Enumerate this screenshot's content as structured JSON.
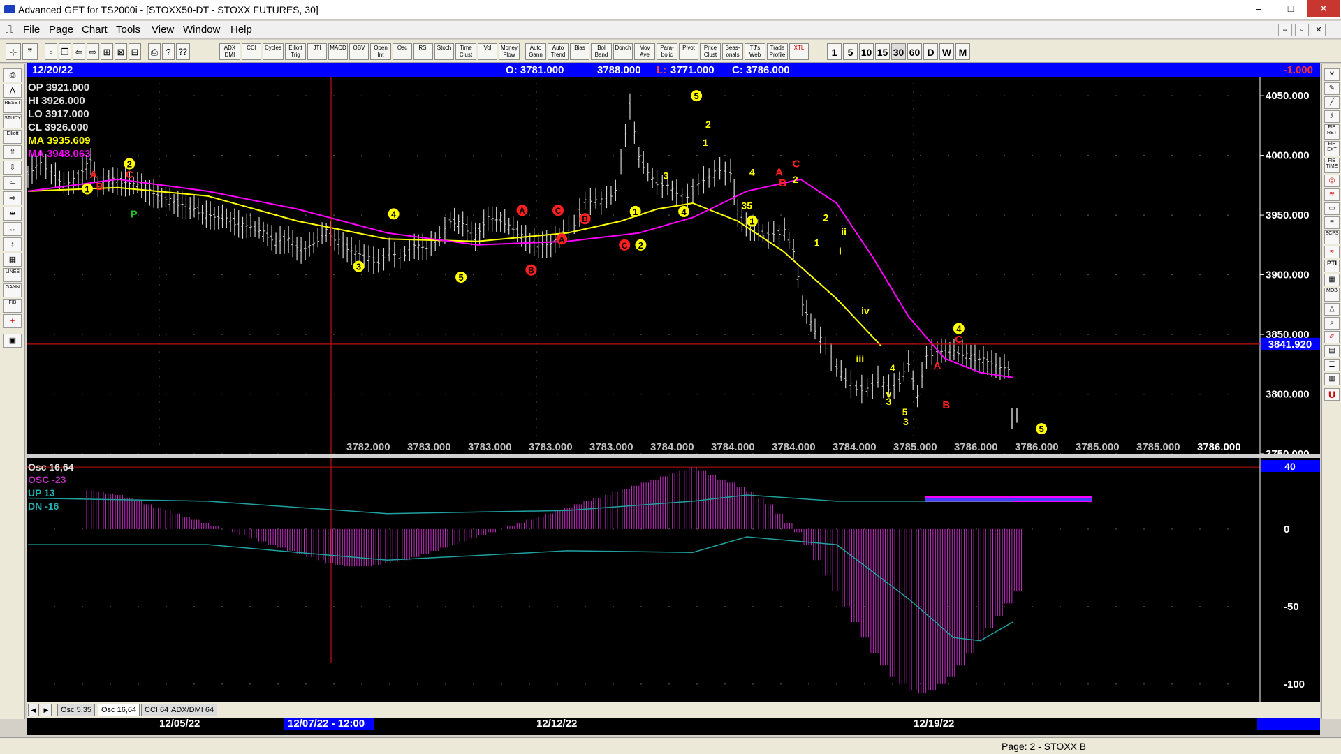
{
  "window": {
    "title": "Advanced GET for TS2000i - [STOXX50-DT - STOXX FUTURES, 30]",
    "minimize": "–",
    "maximize": "□",
    "close": "✕"
  },
  "menu": [
    "File",
    "Page",
    "Chart",
    "Tools",
    "View",
    "Window",
    "Help"
  ],
  "mdi_buttons": [
    "–",
    "▫",
    "✕"
  ],
  "toolbar": {
    "studies": [
      "ADX DMI",
      "CCI",
      "Cycles",
      "Elliott Trig",
      "JTI",
      "MACD",
      "OBV",
      "Open Int",
      "Osc",
      "RSI",
      "Stoch",
      "Time Clust",
      "Vol",
      "Money Flow",
      "Auto Gann",
      "Auto Trend",
      "Bias",
      "Bol Band",
      "Donch",
      "Mov Ave",
      "Para-bolic",
      "Pivot",
      "Price Clust",
      "Seas-onals",
      "TJ's Web",
      "Trade Profile",
      "XTL"
    ],
    "timeframes": [
      "1",
      "5",
      "10",
      "15",
      "30",
      "60",
      "D",
      "W",
      "M"
    ]
  },
  "left_tools": [
    "RESET",
    "STUDY",
    "Elliott",
    "LINES",
    "GANN",
    "FIB"
  ],
  "right_tools": [
    "FIB RET",
    "FIB EXT",
    "FIB TIME",
    "ECPS",
    "PTI",
    "MOB"
  ],
  "colors": {
    "background": "#000000",
    "header_bar": "#0000ff",
    "price_bar": "#d0d0d0",
    "ma_yellow": "#ffff00",
    "ma_magenta": "#ff00ff",
    "wave_yellow": "#ffff00",
    "wave_red": "#ff2020",
    "cursor_red": "#c01010",
    "osc_histogram": "#c030c0",
    "osc_band": "#20a0a0"
  },
  "header": {
    "date": "12/20/22",
    "open": "O: 3781.000",
    "high": "3788.000",
    "low_label": "L:",
    "low": "3771.000",
    "close": "C: 3786.000",
    "change": "-1.000"
  },
  "info": {
    "op": "OP  3921.000",
    "hi": "HI   3926.000",
    "lo": "LO  3917.000",
    "cl": "CL  3926.000",
    "ma1": "MA  3935.609",
    "ma2": "MA  3948.063"
  },
  "price_axis": {
    "ticks": [
      "4050.000",
      "4000.000",
      "3950.000",
      "3900.000",
      "3850.000",
      "3800.000",
      "3750.000"
    ],
    "cursor_price": "3841.920"
  },
  "time_values": [
    "3782.000",
    "3783.000",
    "3783.000",
    "3783.000",
    "3783.000",
    "3784.000",
    "3784.000",
    "3784.000",
    "3784.000",
    "3785.000",
    "3786.000",
    "3786.000",
    "3785.000",
    "3785.000",
    "3786.000"
  ],
  "oscillator": {
    "title": "Osc 16,64",
    "osc": "OSC -23",
    "up": "UP   13",
    "dn": "DN   -16",
    "badge": "40",
    "ticks": [
      "0",
      "-50",
      "-100"
    ]
  },
  "tabs": [
    "Osc 5,35",
    "Osc 16,64",
    "CCI 64",
    "ADX/DMI 64"
  ],
  "date_axis": {
    "labels": [
      "12/05/22",
      "12/12/22",
      "12/19/22"
    ],
    "cursor_label": "12/07/22 - 12:00"
  },
  "status": {
    "page": "Page: 2 - STOXX B"
  },
  "chart_data": {
    "type": "line",
    "ylim": [
      3750,
      4060
    ],
    "price_path": [
      [
        0,
        3985
      ],
      [
        14,
        3994
      ],
      [
        26,
        3986
      ],
      [
        40,
        3975
      ],
      [
        56,
        3982
      ],
      [
        70,
        3996
      ],
      [
        78,
        3975
      ],
      [
        90,
        3980
      ],
      [
        104,
        3978
      ],
      [
        122,
        3975
      ],
      [
        140,
        3968
      ],
      [
        158,
        3962
      ],
      [
        176,
        3958
      ],
      [
        194,
        3952
      ],
      [
        212,
        3948
      ],
      [
        230,
        3944
      ],
      [
        248,
        3940
      ],
      [
        262,
        3935
      ],
      [
        276,
        3928
      ],
      [
        290,
        3930
      ],
      [
        304,
        3920
      ],
      [
        318,
        3926
      ],
      [
        332,
        3936
      ],
      [
        346,
        3928
      ],
      [
        360,
        3920
      ],
      [
        374,
        3916
      ],
      [
        390,
        3910
      ],
      [
        402,
        3920
      ],
      [
        414,
        3914
      ],
      [
        430,
        3925
      ],
      [
        444,
        3922
      ],
      [
        458,
        3930
      ],
      [
        470,
        3945
      ],
      [
        484,
        3942
      ],
      [
        498,
        3932
      ],
      [
        512,
        3948
      ],
      [
        526,
        3945
      ],
      [
        540,
        3938
      ],
      [
        554,
        3930
      ],
      [
        568,
        3926
      ],
      [
        582,
        3926
      ],
      [
        596,
        3935
      ],
      [
        608,
        3942
      ],
      [
        620,
        3962
      ],
      [
        632,
        3962
      ],
      [
        644,
        3962
      ],
      [
        654,
        3970
      ],
      [
        660,
        3996
      ],
      [
        670,
        4040
      ],
      [
        680,
        3998
      ],
      [
        690,
        3985
      ],
      [
        700,
        3976
      ],
      [
        712,
        3975
      ],
      [
        722,
        3968
      ],
      [
        734,
        3965
      ],
      [
        746,
        3976
      ],
      [
        758,
        3982
      ],
      [
        770,
        3988
      ],
      [
        782,
        3985
      ],
      [
        790,
        3952
      ],
      [
        804,
        3938
      ],
      [
        818,
        3934
      ],
      [
        830,
        3934
      ],
      [
        842,
        3936
      ],
      [
        852,
        3920
      ],
      [
        862,
        3875
      ],
      [
        876,
        3852
      ],
      [
        888,
        3840
      ],
      [
        900,
        3822
      ],
      [
        910,
        3812
      ],
      [
        922,
        3805
      ],
      [
        934,
        3804
      ],
      [
        946,
        3812
      ],
      [
        958,
        3805
      ],
      [
        970,
        3810
      ],
      [
        980,
        3825
      ],
      [
        990,
        3798
      ],
      [
        1000,
        3832
      ],
      [
        1012,
        3836
      ],
      [
        1026,
        3835
      ],
      [
        1040,
        3834
      ],
      [
        1054,
        3830
      ],
      [
        1068,
        3828
      ],
      [
        1082,
        3822
      ],
      [
        1096,
        3821
      ]
    ],
    "ma_yellow": [
      [
        0,
        3970
      ],
      [
        100,
        3973
      ],
      [
        200,
        3966
      ],
      [
        300,
        3945
      ],
      [
        400,
        3930
      ],
      [
        500,
        3928
      ],
      [
        600,
        3935
      ],
      [
        660,
        3945
      ],
      [
        700,
        3955
      ],
      [
        740,
        3960
      ],
      [
        790,
        3945
      ],
      [
        840,
        3920
      ],
      [
        900,
        3880
      ],
      [
        950,
        3840
      ]
    ],
    "ma_magenta": [
      [
        0,
        3970
      ],
      [
        100,
        3980
      ],
      [
        200,
        3970
      ],
      [
        300,
        3955
      ],
      [
        400,
        3935
      ],
      [
        500,
        3925
      ],
      [
        600,
        3928
      ],
      [
        680,
        3935
      ],
      [
        740,
        3948
      ],
      [
        800,
        3970
      ],
      [
        860,
        3980
      ],
      [
        900,
        3960
      ],
      [
        940,
        3915
      ],
      [
        980,
        3865
      ],
      [
        1020,
        3830
      ],
      [
        1060,
        3818
      ],
      [
        1096,
        3814
      ]
    ],
    "wave_labels_yellow": [
      [
        "1",
        66,
        3972
      ],
      [
        "2",
        113,
        3993
      ],
      [
        "3",
        368,
        3907
      ],
      [
        "4",
        407,
        3951
      ],
      [
        "5",
        482,
        3898
      ],
      [
        "1",
        676,
        3953
      ],
      [
        "2",
        682,
        3925
      ],
      [
        "3",
        710,
        3983
      ],
      [
        "4",
        730,
        3953
      ],
      [
        "5",
        744,
        4050
      ],
      [
        "2",
        757,
        4026
      ],
      [
        "1",
        754,
        4011
      ],
      [
        "4",
        806,
        3986
      ],
      [
        "35",
        800,
        3958
      ],
      [
        "1",
        806,
        3945
      ],
      [
        "2",
        854,
        3980
      ],
      [
        "1",
        878,
        3927
      ],
      [
        "2",
        888,
        3948
      ],
      [
        "ii",
        908,
        3936
      ],
      [
        "i",
        904,
        3920
      ],
      [
        "iv",
        932,
        3870
      ],
      [
        "iii",
        926,
        3830
      ],
      [
        "4",
        962,
        3822
      ],
      [
        "v",
        958,
        3800
      ],
      [
        "3",
        958,
        3794
      ],
      [
        "5",
        976,
        3785
      ],
      [
        "3",
        977,
        3777
      ],
      [
        "4",
        1036,
        3855
      ],
      [
        "5",
        1128,
        3771
      ]
    ],
    "wave_labels_red": [
      [
        "C",
        113,
        3984
      ],
      [
        "A",
        73,
        3984
      ],
      [
        "B",
        80,
        3974
      ],
      [
        "A",
        550,
        3954
      ],
      [
        "C",
        590,
        3954
      ],
      [
        "B",
        620,
        3947
      ],
      [
        "A",
        594,
        3930
      ],
      [
        "B",
        560,
        3904
      ],
      [
        "C",
        664,
        3925
      ],
      [
        "A",
        836,
        3986
      ],
      [
        "C",
        855,
        3993
      ],
      [
        "B",
        840,
        3977
      ],
      [
        "C",
        1036,
        3846
      ],
      [
        "A",
        1012,
        3824
      ],
      [
        "B",
        1022,
        3791
      ]
    ],
    "p_label": [
      "P",
      118,
      3951
    ],
    "cursor": {
      "x_index": 355,
      "price": 3841.92
    },
    "oscillator": {
      "ylim": [
        -110,
        45
      ],
      "histogram": [
        25,
        24,
        23,
        22,
        20,
        18,
        16,
        14,
        12,
        10,
        8,
        6,
        4,
        2,
        0,
        -2,
        -4,
        -6,
        -8,
        -10,
        -12,
        -14,
        -16,
        -18,
        -20,
        -22,
        -23,
        -24,
        -24,
        -24,
        -23,
        -22,
        -21,
        -20,
        -18,
        -16,
        -14,
        -12,
        -10,
        -8,
        -6,
        -4,
        -2,
        0,
        2,
        4,
        6,
        8,
        10,
        12,
        14,
        16,
        18,
        20,
        22,
        24,
        26,
        28,
        30,
        32,
        34,
        36,
        38,
        40,
        38,
        35,
        32,
        30,
        27,
        24,
        20,
        16,
        10,
        4,
        -2,
        -10,
        -20,
        -30,
        -40,
        -50,
        -60,
        -70,
        -80,
        -88,
        -95,
        -100,
        -104,
        -106,
        -104,
        -100,
        -95,
        -88,
        -80,
        -72,
        -64,
        -56,
        -48,
        -40
      ],
      "up_band": [
        [
          0,
          20
        ],
        [
          200,
          18
        ],
        [
          400,
          10
        ],
        [
          600,
          12
        ],
        [
          740,
          18
        ],
        [
          800,
          22
        ],
        [
          900,
          18
        ],
        [
          1000,
          18
        ],
        [
          1096,
          18
        ]
      ],
      "dn_band": [
        [
          0,
          -10
        ],
        [
          200,
          -10
        ],
        [
          400,
          -20
        ],
        [
          600,
          -14
        ],
        [
          740,
          -15
        ],
        [
          800,
          -5
        ],
        [
          900,
          -10
        ],
        [
          980,
          -45
        ],
        [
          1030,
          -70
        ],
        [
          1060,
          -72
        ],
        [
          1096,
          -60
        ]
      ]
    }
  }
}
